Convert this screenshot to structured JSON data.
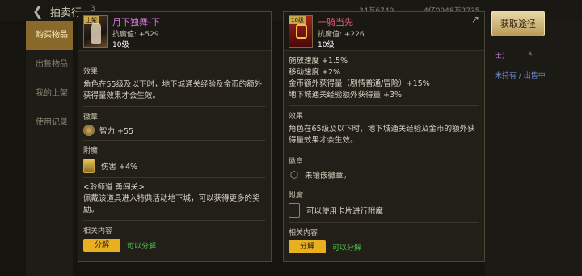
{
  "header": {
    "back_label": "拍卖行",
    "left_val": "3",
    "mid_val": "34万6749",
    "right_val": "4亿0948万2735"
  },
  "sidebar": {
    "items": [
      {
        "label": "购买物品"
      },
      {
        "label": "出售物品"
      },
      {
        "label": "我的上架"
      },
      {
        "label": "使用记录"
      }
    ]
  },
  "background": {
    "right_text1": "士）",
    "right_text2": "未持有 / 出售中"
  },
  "get_button": "获取途径",
  "item1": {
    "badge": "上架",
    "name": "月下独舞-下",
    "stat": "抗魔值: +529",
    "level": "10级",
    "effect_title": "效果",
    "effect_text": "角色在55级及以下时，地下城通关经验及金币的额外获得量效果才会生效。",
    "emblem_title": "徽章",
    "emblem_value": "智力 +55",
    "enchant_title": "附魔",
    "enchant_value": "伤害 +4%",
    "note_title": "<聆师道 勇闯关>",
    "note_text": "佩戴该道具进入特典活动地下城，可以获得更多的奖励。",
    "related_title": "相关内容",
    "btn_label": "分解",
    "btn_status": "可以分解"
  },
  "item2": {
    "badge": "10级",
    "name": "一骑当先",
    "stat": "抗魔值: +226",
    "level": "10级",
    "stats": [
      "施放速度 +1.5%",
      "移动速度 +2%",
      "金币额外获得量（剧情普通/冒险）+15%",
      "地下城通关经验额外获得量 +3%"
    ],
    "effect_title": "效果",
    "effect_text": "角色在65级及以下时，地下城通关经验及金币的额外获得量效果才会生效。",
    "emblem_title": "徽章",
    "emblem_value": "未镶嵌徽章。",
    "enchant_title": "附魔",
    "enchant_value": "可以使用卡片进行附魔",
    "related_title": "相关内容",
    "btn_label": "分解",
    "btn_status": "可以分解"
  },
  "colors": {
    "accent": "#e8b020",
    "purple_name": "#d87ad8",
    "red_name": "#e85a78",
    "green": "#52c252"
  }
}
